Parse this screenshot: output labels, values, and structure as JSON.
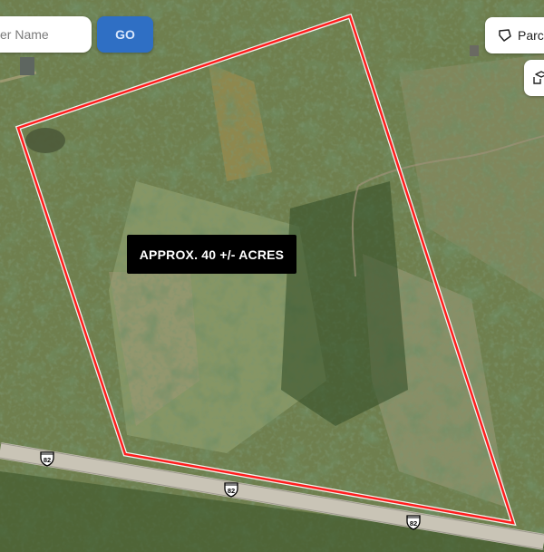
{
  "search": {
    "placeholder": "er Name"
  },
  "go_button": {
    "label": "GO",
    "color": "#2f6fc4"
  },
  "toolbar": {
    "parcel_label": "Parce",
    "parcel_icon": "polygon-icon",
    "layers_icon": "layers-icon"
  },
  "parcel": {
    "label": "APPROX. 40 +/- ACRES",
    "outline_color": "#ff1e1e"
  },
  "highway": {
    "route": "82",
    "shield_icon": "us-highway-shield-icon"
  },
  "colors": {
    "land": "#7c8a5a",
    "trees": "#2f4a24",
    "road": "#b9b4a6",
    "label_bg": "#000000"
  }
}
